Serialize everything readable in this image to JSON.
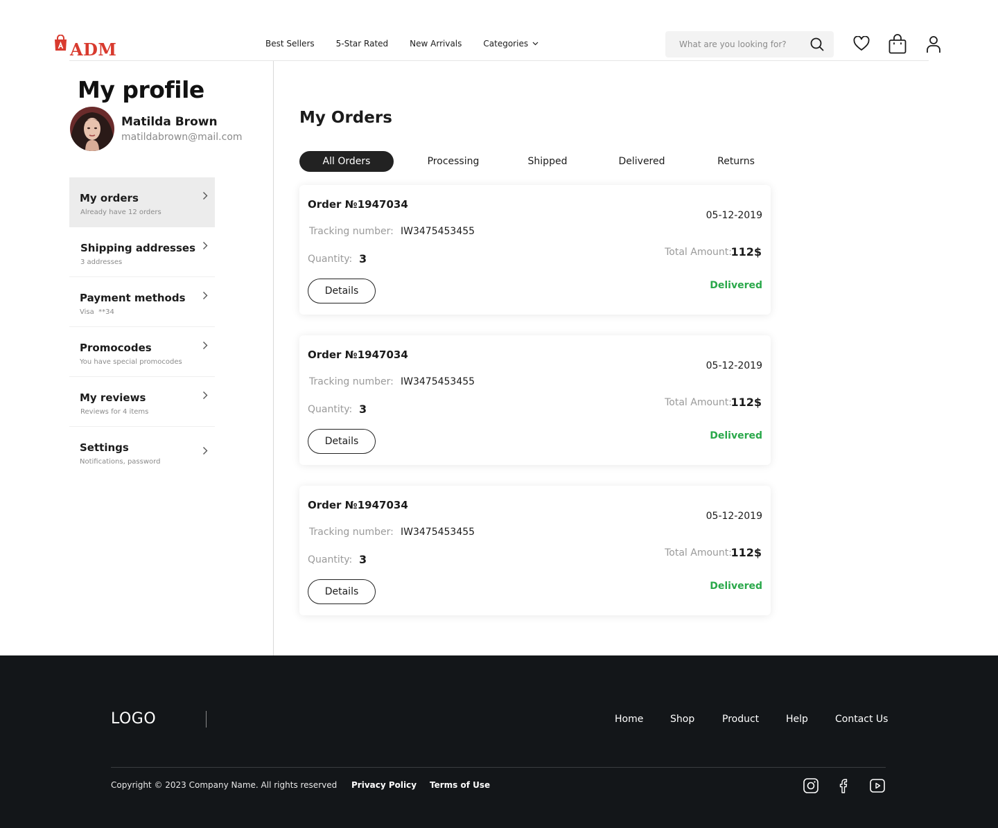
{
  "header": {
    "logo_text": "ADM",
    "nav": [
      "Best Sellers",
      "5-Star Rated",
      "New Arrivals",
      "Categories"
    ],
    "search_placeholder": "What are you looking for?",
    "brand_color": "#d83a2e"
  },
  "sidebar": {
    "title": "My profile",
    "user": {
      "name": "Matilda Brown",
      "email": "matildabrown@mail.com"
    },
    "items": [
      {
        "label": "My orders",
        "sub": "Already have 12 orders"
      },
      {
        "label": "Shipping addresses",
        "sub": "3 addresses"
      },
      {
        "label": "Payment methods",
        "sub": "Visa  **34"
      },
      {
        "label": "Promocodes",
        "sub": "You have special promocodes"
      },
      {
        "label": "My reviews",
        "sub": "Reviews for 4 items"
      },
      {
        "label": "Settings",
        "sub": "Notifications, password"
      }
    ]
  },
  "main": {
    "title": "My Orders",
    "tabs": [
      "All Orders",
      "Processing",
      "Shipped",
      "Delivered",
      "Returns"
    ],
    "orders": [
      {
        "id": "Order №1947034",
        "date": "05-12-2019",
        "tracking_label": "Tracking number:",
        "tracking": "IW3475453455",
        "quantity_label": "Quantity:",
        "quantity": "3",
        "total_label": "Total Amount:",
        "total": "112$",
        "button": "Details",
        "status": "Delivered"
      },
      {
        "id": "Order №1947034",
        "date": "05-12-2019",
        "tracking_label": "Tracking number:",
        "tracking": "IW3475453455",
        "quantity_label": "Quantity:",
        "quantity": "3",
        "total_label": "Total Amount:",
        "total": "112$",
        "button": "Details",
        "status": "Delivered"
      },
      {
        "id": "Order №1947034",
        "date": "05-12-2019",
        "tracking_label": "Tracking number:",
        "tracking": "IW3475453455",
        "quantity_label": "Quantity:",
        "quantity": "3",
        "total_label": "Total Amount:",
        "total": "112$",
        "button": "Details",
        "status": "Delivered"
      }
    ],
    "status_color": "#2aa84a"
  },
  "footer": {
    "logo": "LOGO",
    "nav": [
      "Home",
      "Shop",
      "Product",
      "Help",
      "Contact Us"
    ],
    "copyright": "Copyright © 2023 Company Name. All rights reserved",
    "links": [
      "Privacy Policy",
      "Terms of Use"
    ],
    "social": [
      "instagram-icon",
      "facebook-icon",
      "youtube-icon"
    ],
    "background": "#131619"
  }
}
